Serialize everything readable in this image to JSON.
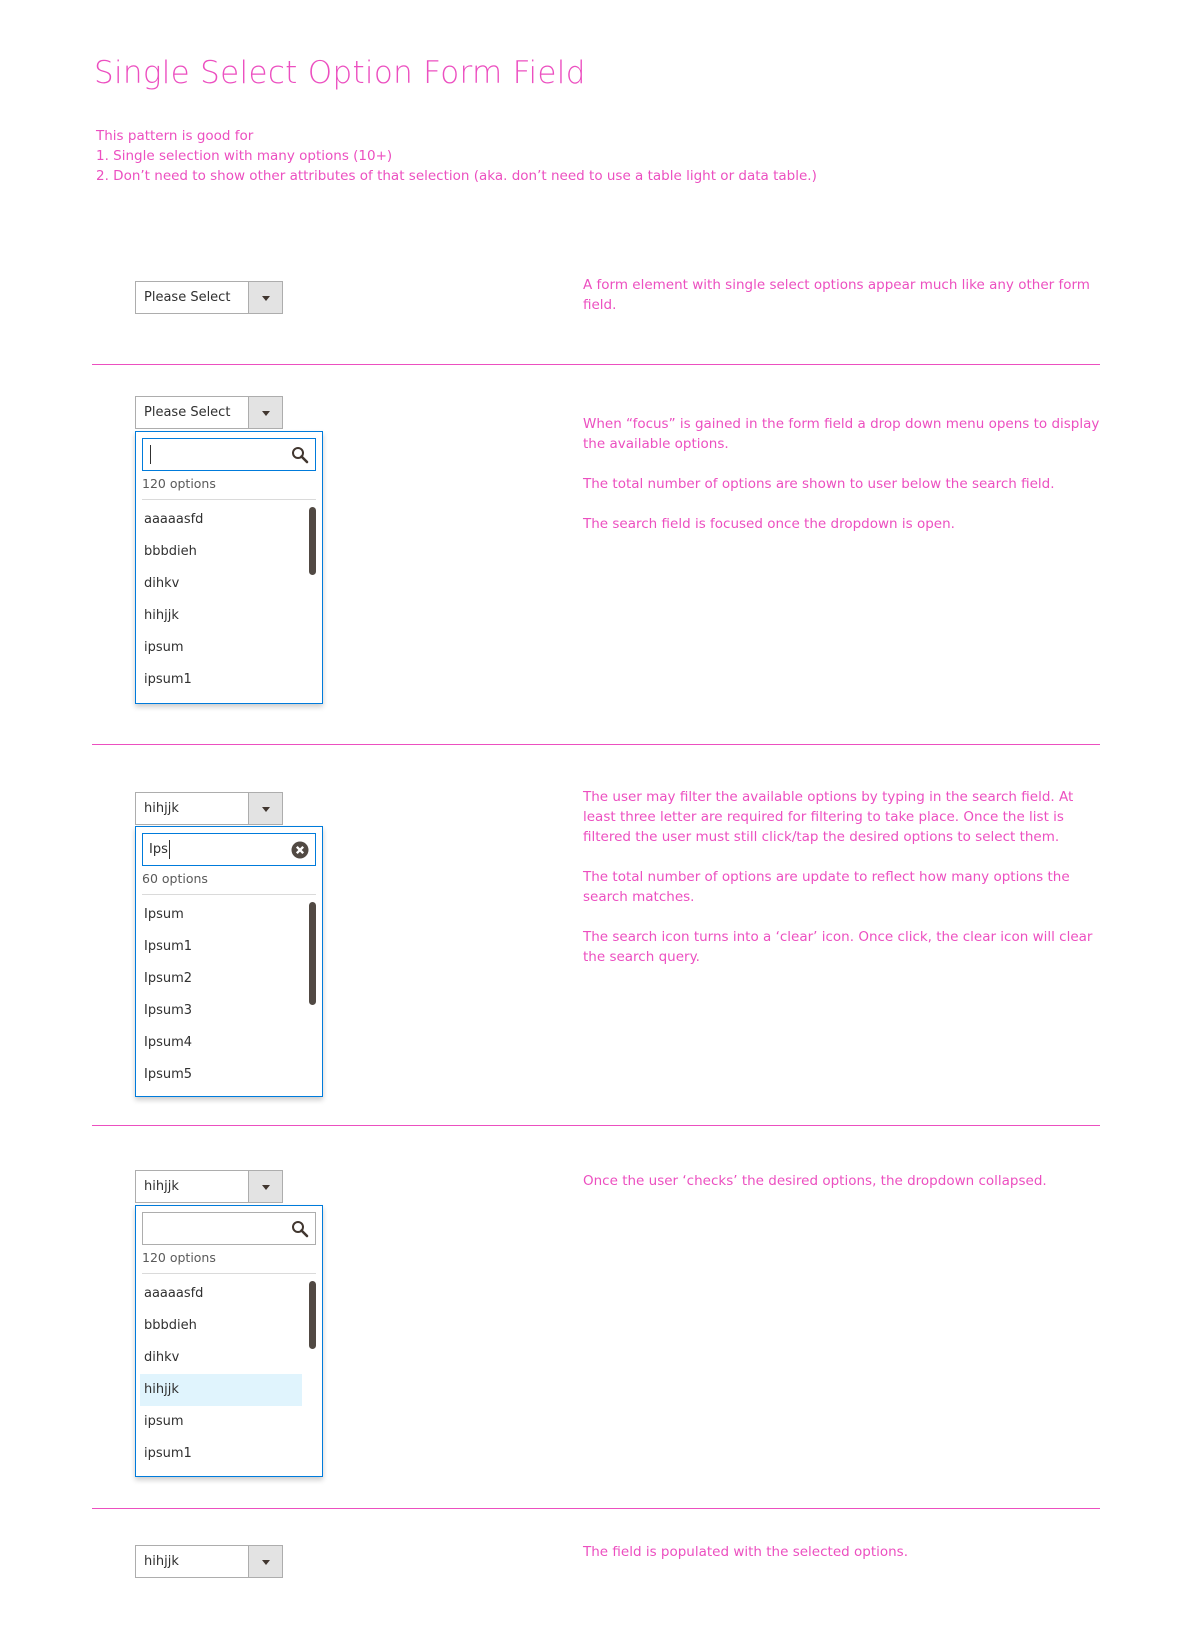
{
  "title": "Single Select Option Form Field",
  "intro": [
    "This pattern is good for",
    "1. Single selection with many options (10+)",
    "2. Don’t need to show other attributes of that selection (aka. don’t need to use a table light or data table.)"
  ],
  "colors": {
    "accent": "#ec4fc0",
    "focus": "#007bdb",
    "selected_bg": "#e0f4fd",
    "scrollbar": "#514943"
  },
  "sections": [
    {
      "select_value": "Please Select",
      "description": [
        "A form element with single select options appear much like any other form field."
      ]
    },
    {
      "select_value": "Please Select",
      "search": {
        "value": "",
        "icon": "search-icon"
      },
      "count": "120 options",
      "options": [
        "aaaaasfd",
        "bbbdieh",
        "dihkv",
        "hihjjk",
        "ipsum",
        "ipsum1"
      ],
      "description": [
        "When “focus” is gained in the form field a drop down menu opens to display the available options.",
        "The total number of options are shown to user below the search field.",
        "The search field is focused once the dropdown is open."
      ]
    },
    {
      "select_value": "hihjjk",
      "search": {
        "value": "Ips",
        "icon": "clear-icon"
      },
      "count": "60 options",
      "options": [
        "Ipsum",
        "Ipsum1",
        "Ipsum2",
        "Ipsum3",
        "Ipsum4",
        "Ipsum5"
      ],
      "description": [
        "The user may filter the available options by typing in the search field.  At least three letter are required for filtering to take place.  Once the list is filtered the user must still click/tap the desired options to select them.",
        "The total number of options are update to reflect how many options the search matches.",
        "The search icon turns into a ‘clear’ icon. Once click, the clear icon will clear the search query."
      ]
    },
    {
      "select_value": "hihjjk",
      "search": {
        "value": "",
        "icon": "search-icon"
      },
      "count": "120 options",
      "options": [
        "aaaaasfd",
        "bbbdieh",
        "dihkv",
        "hihjjk",
        "ipsum",
        "ipsum1"
      ],
      "selected_option": "hihjjk",
      "description": [
        "Once the user ‘checks’ the desired options, the dropdown collapsed."
      ]
    },
    {
      "select_value": "hihjjk",
      "description": [
        "The field is populated with the selected options."
      ]
    }
  ]
}
